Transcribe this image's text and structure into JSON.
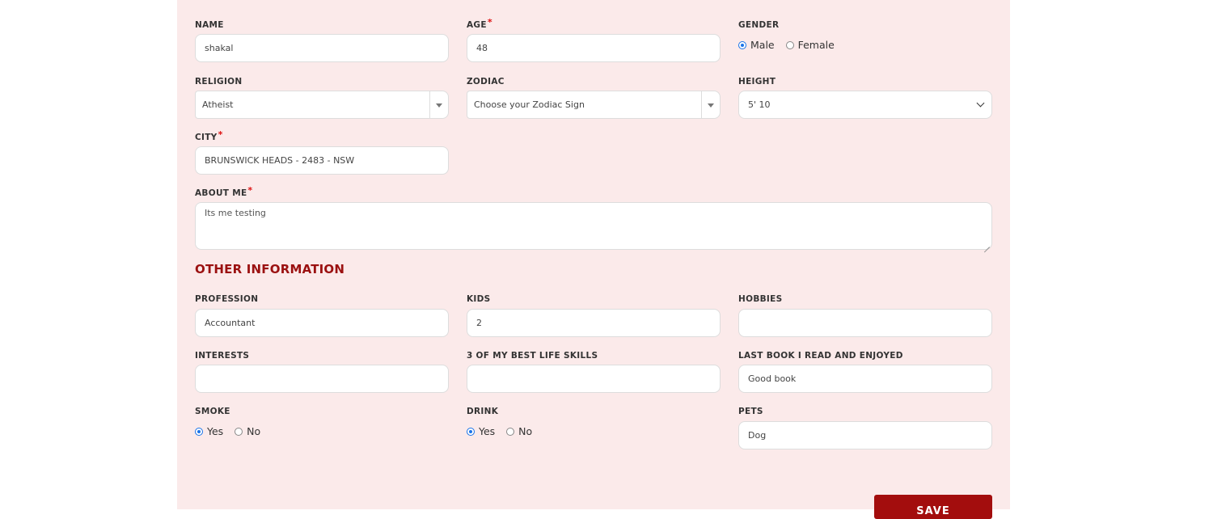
{
  "form": {
    "name": {
      "label": "NAME",
      "value": "shakal"
    },
    "age": {
      "label": "AGE",
      "value": "48",
      "required_mark": "*"
    },
    "gender": {
      "label": "GENDER",
      "options": [
        "Male",
        "Female"
      ],
      "selected": "Male"
    },
    "religion": {
      "label": "RELIGION",
      "value": "Atheist"
    },
    "zodiac": {
      "label": "ZODIAC",
      "value": "Choose your Zodiac Sign"
    },
    "height": {
      "label": "HEIGHT",
      "value": "5' 10"
    },
    "city": {
      "label": "CITY",
      "value": "BRUNSWICK HEADS - 2483 - NSW",
      "required_mark": "*"
    },
    "about_me": {
      "label": "ABOUT ME",
      "value": "Its me testing",
      "required_mark": "*"
    }
  },
  "other_info": {
    "title": "OTHER INFORMATION",
    "profession": {
      "label": "PROFESSION",
      "value": "Accountant"
    },
    "kids": {
      "label": "KIDS",
      "value": "2"
    },
    "hobbies": {
      "label": "HOBBIES",
      "value": ""
    },
    "interests": {
      "label": "INTERESTS",
      "value": ""
    },
    "life_skills": {
      "label": "3 OF MY BEST LIFE SKILLS",
      "value": ""
    },
    "last_book": {
      "label": "LAST BOOK I READ AND ENJOYED",
      "value": "Good book"
    },
    "smoke": {
      "label": "SMOKE",
      "options": [
        "Yes",
        "No"
      ],
      "selected": "Yes"
    },
    "drink": {
      "label": "DRINK",
      "options": [
        "Yes",
        "No"
      ],
      "selected": "Yes"
    },
    "pets": {
      "label": "PETS",
      "value": "Dog"
    }
  },
  "save_label": "SAVE",
  "colors": {
    "panel_bg": "#fbeaea",
    "accent": "#9b1111",
    "button": "#a30d0d",
    "radio": "#1a73e8"
  }
}
